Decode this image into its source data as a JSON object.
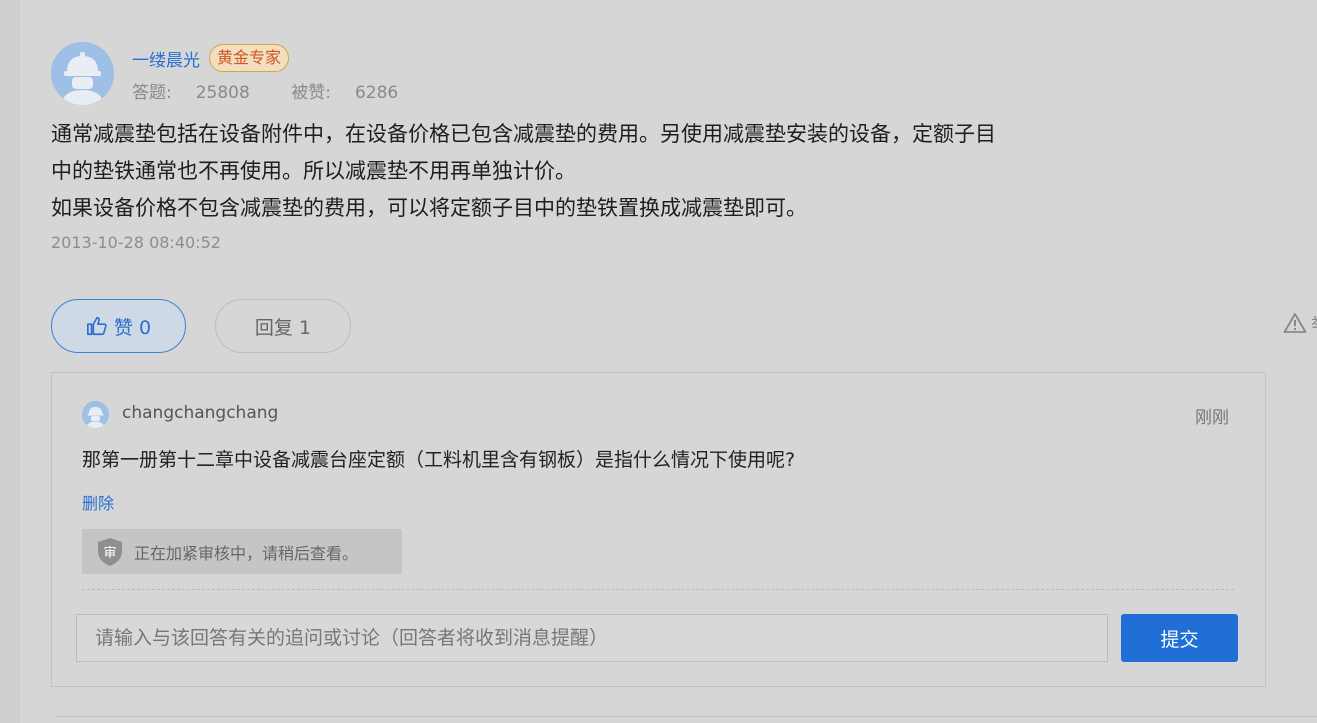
{
  "answer_card": {
    "user_name": "一缕晨光",
    "badge": "黄金专家",
    "stats": {
      "answers_label": "答题:",
      "answers_count": "25808",
      "likes_label": "被赞:",
      "likes_count": "6286"
    },
    "paragraphs": [
      "通常减震垫包括在设备附件中，在设备价格已包含减震垫的费用。另使用减震垫安装的设备，定额子目",
      "中的垫铁通常也不再使用。所以减震垫不用再单独计价。",
      "如果设备价格不包含减震垫的费用，可以将定额子目中的垫铁置换成减震垫即可。"
    ],
    "timestamp": "2013-10-28 08:40:52"
  },
  "actions": {
    "like_label": "赞 0",
    "reply_label": "回复 1",
    "report_label": "举"
  },
  "comment": {
    "user_name": "changchangchang",
    "time": "刚刚",
    "text": "那第一册第十二章中设备减震台座定额（工料机里含有钢板）是指什么情况下使用呢?",
    "delete_label": "删除",
    "review_notice": "正在加紧审核中，请稍后查看。",
    "review_icon_char": "审"
  },
  "reply_form": {
    "placeholder": "请输入与该回答有关的追问或讨论（回答者将收到消息提醒）",
    "submit_label": "提交"
  },
  "colors": {
    "link_blue": "#2a6fd1",
    "submit_blue": "#1f6fd6",
    "badge_text": "#d5532a"
  }
}
